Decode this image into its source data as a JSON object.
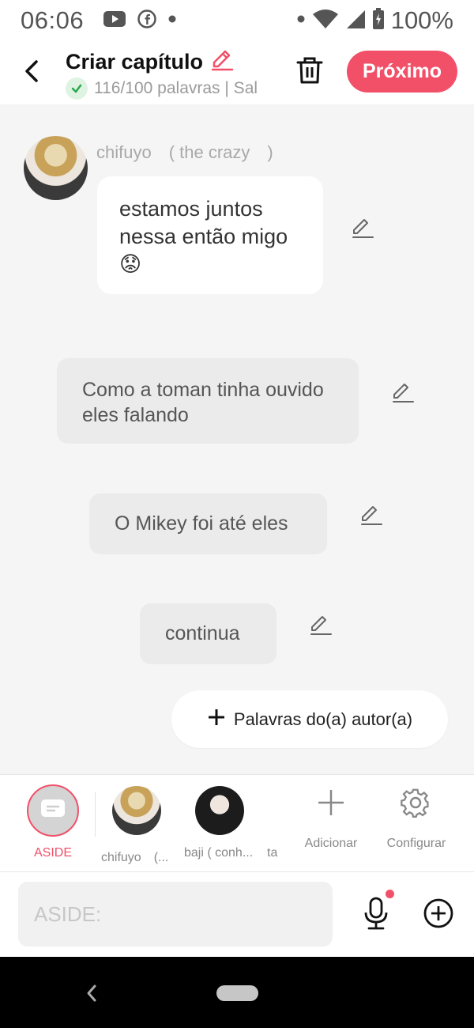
{
  "status_bar": {
    "time": "06:06",
    "battery": "100%",
    "icons": [
      "youtube-icon",
      "facebook-icon",
      "dot-icon",
      "wifi-icon",
      "signal-icon",
      "battery-icon"
    ]
  },
  "header": {
    "title": "Criar capítulo",
    "word_count": "116/100 palavras | Sal",
    "next_label": "Próximo",
    "accent": "#f25068"
  },
  "messages": [
    {
      "character": "chifuyo　( the crazy　)",
      "text": "estamos juntos nessa então migo 😟"
    },
    {
      "character": "",
      "text": "Como a toman tinha ouvido eles falando"
    },
    {
      "character": "",
      "text": "O Mikey foi até eles"
    },
    {
      "character": "",
      "text": "continua"
    }
  ],
  "author_button": {
    "label": "Palavras do(a) autor(a)"
  },
  "character_bar": {
    "aside_label": "ASIDE",
    "characters": [
      {
        "label": "chifuyo　(..."
      },
      {
        "label": "baji ( conh..."
      },
      {
        "label": "ta"
      }
    ],
    "add_label": "Adicionar",
    "settings_label": "Configurar"
  },
  "input": {
    "placeholder": "ASIDE:",
    "value": ""
  }
}
